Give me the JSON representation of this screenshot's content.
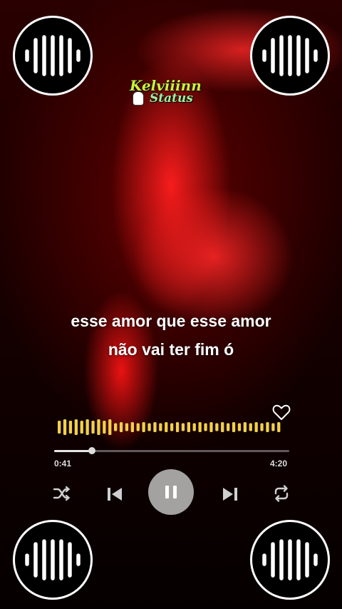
{
  "logo": {
    "line1": "Kelviiinn",
    "line2": "Status"
  },
  "lyrics": {
    "line1": "esse amor que esse amor",
    "line2": "não vai ter fim ó"
  },
  "player": {
    "elapsed": "0:41",
    "duration": "4:20",
    "progress_fraction": 0.16,
    "liked": false,
    "state": "playing"
  },
  "icons": {
    "corner": "audio-bars-icon",
    "heart": "heart-outline-icon",
    "shuffle": "shuffle-icon",
    "previous": "skip-previous-icon",
    "pause": "pause-icon",
    "next": "skip-next-icon",
    "repeat": "repeat-icon"
  },
  "colors": {
    "waveform": "#f2d04a",
    "background_glow": "#ff1e1e",
    "logo_green": "#c9f23a"
  }
}
